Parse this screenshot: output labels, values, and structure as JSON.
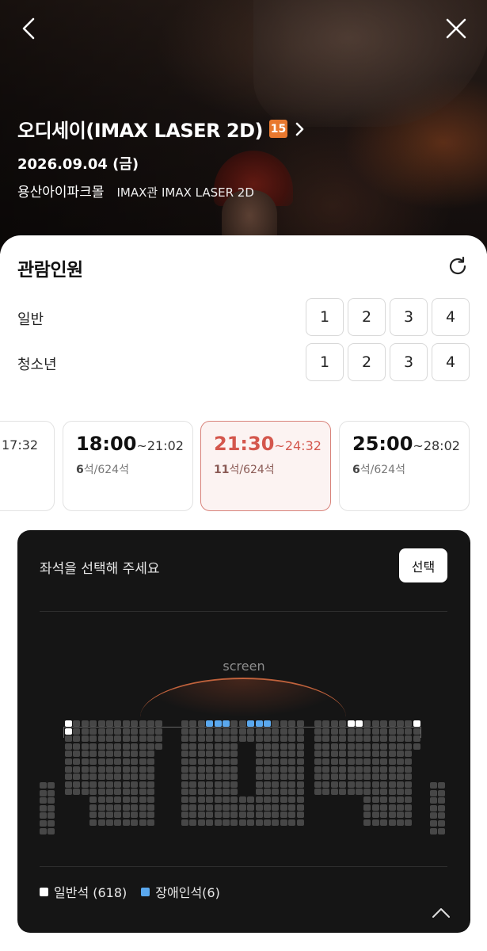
{
  "header": {
    "movie_title": "오디세이(IMAX LASER 2D)",
    "age_rating": "15",
    "date": "2026.09.04 (금)",
    "theater": "용산아이파크몰",
    "hall": "IMAX관 IMAX LASER 2D"
  },
  "audience": {
    "title": "관람인원",
    "rows": [
      {
        "label": "일반",
        "options": [
          "1",
          "2",
          "3",
          "4"
        ]
      },
      {
        "label": "청소년",
        "options": [
          "1",
          "2",
          "3",
          "4"
        ]
      }
    ]
  },
  "showtimes": [
    {
      "start": "",
      "end": "17:32",
      "seats_left": "",
      "seats_total": ""
    },
    {
      "start": "18:00",
      "end": "~21:02",
      "seats_left": "6",
      "seats_total": "석/624석"
    },
    {
      "start": "21:30",
      "end": "~24:32",
      "seats_left": "11",
      "seats_total": "석/624석",
      "selected": true
    },
    {
      "start": "25:00",
      "end": "~28:02",
      "seats_left": "6",
      "seats_total": "석/624석"
    }
  ],
  "seat_panel": {
    "prompt": "좌석을 선택해 주세요",
    "select_button": "선택",
    "screen_label": "screen",
    "legend": [
      {
        "label": "일반석 (618)",
        "color": "#ffffff"
      },
      {
        "label": "장애인석(6)",
        "color": "#5aa8ee"
      }
    ]
  },
  "colors": {
    "accent": "#d4574d",
    "selected_bg": "#fcf3f2",
    "panel_bg": "#151515",
    "age_badge": "#e8782e",
    "accessible_seat": "#5aa8ee"
  }
}
